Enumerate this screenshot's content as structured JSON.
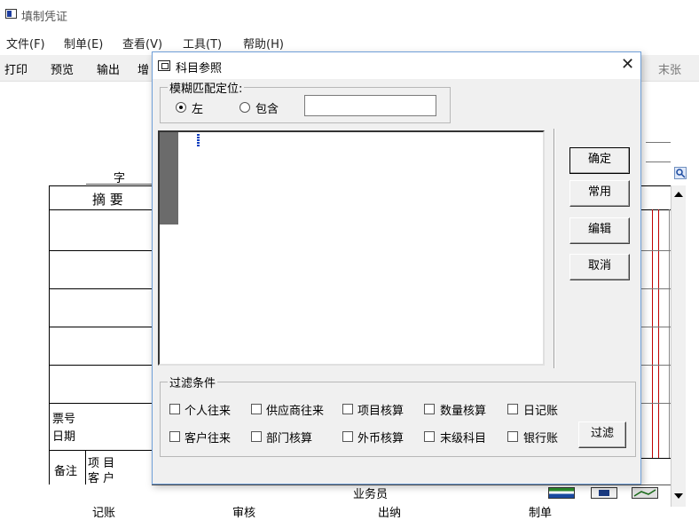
{
  "window": {
    "title": "填制凭证"
  },
  "menu": [
    {
      "label": "文件(F)"
    },
    {
      "label": "制单(E)"
    },
    {
      "label": "查看(V)"
    },
    {
      "label": "工具(T)"
    },
    {
      "label": "帮助(H)"
    }
  ],
  "toolbar": {
    "print": "打印",
    "preview": "预览",
    "export": "输出",
    "add_partial": "增",
    "last_partial": "末张"
  },
  "voucher": {
    "word_label": "字",
    "summary_header": "摘 要",
    "ticket_no": "票号",
    "date": "日期",
    "remarks": "备注",
    "project": "项 目",
    "customer": "客 户",
    "salesperson": "业务员",
    "bookkeeper": "记账",
    "reviewer": "审核",
    "cashier": "出纳",
    "maker": "制单"
  },
  "dialog": {
    "title": "科目参照",
    "close_glyph": "✕",
    "fuzzy": {
      "legend": "模糊匹配定位:",
      "option_left": "左",
      "option_contains": "包含",
      "selected": "左",
      "value": ""
    },
    "buttons": {
      "ok": "确定",
      "common": "常用",
      "edit": "编辑",
      "cancel": "取消",
      "filter": "过滤"
    },
    "filter": {
      "legend": "过滤条件",
      "row1": [
        {
          "label": "个人往来",
          "checked": false
        },
        {
          "label": "供应商往来",
          "checked": false
        },
        {
          "label": "项目核算",
          "checked": false
        },
        {
          "label": "数量核算",
          "checked": false
        },
        {
          "label": "日记账",
          "checked": false
        }
      ],
      "row2": [
        {
          "label": "客户往来",
          "checked": false
        },
        {
          "label": "部门核算",
          "checked": false
        },
        {
          "label": "外币核算",
          "checked": false
        },
        {
          "label": "末级科目",
          "checked": false
        },
        {
          "label": "银行账",
          "checked": false
        }
      ]
    }
  }
}
